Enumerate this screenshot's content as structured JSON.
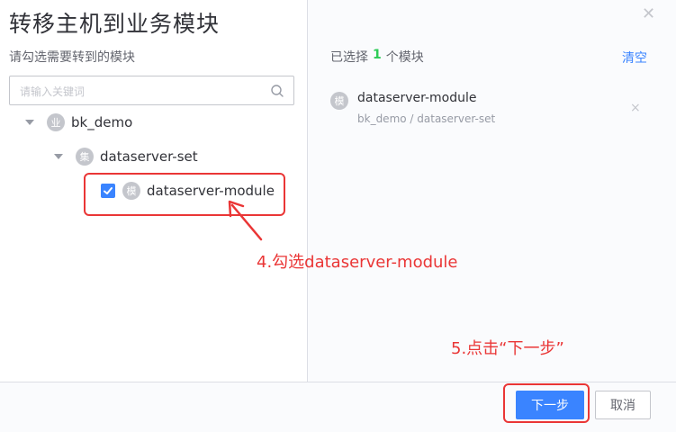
{
  "dialog": {
    "title": "转移主机到业务模块",
    "close_icon": "close-icon"
  },
  "left": {
    "subtitle": "请勾选需要转到的模块",
    "search_placeholder": "请输入关键词",
    "tree": {
      "business": {
        "badge": "业",
        "label": "bk_demo"
      },
      "set": {
        "badge": "集",
        "label": "dataserver-set"
      },
      "module": {
        "badge": "模",
        "label": "dataserver-module",
        "checked": true
      }
    }
  },
  "right": {
    "selected_prefix": "已选择",
    "selected_count": "1",
    "selected_suffix": "个模块",
    "clear_label": "清空",
    "items": [
      {
        "badge": "模",
        "name": "dataserver-module",
        "path": "bk_demo / dataserver-set",
        "remove": "×"
      }
    ]
  },
  "annotations": {
    "step4": "4.勾选dataserver-module",
    "step5": "5.点击“下一步”"
  },
  "footer": {
    "next_label": "下一步",
    "cancel_label": "取消"
  },
  "colors": {
    "accent": "#3a84ff",
    "annotation": "#ea3636",
    "count": "#2dcb56"
  }
}
